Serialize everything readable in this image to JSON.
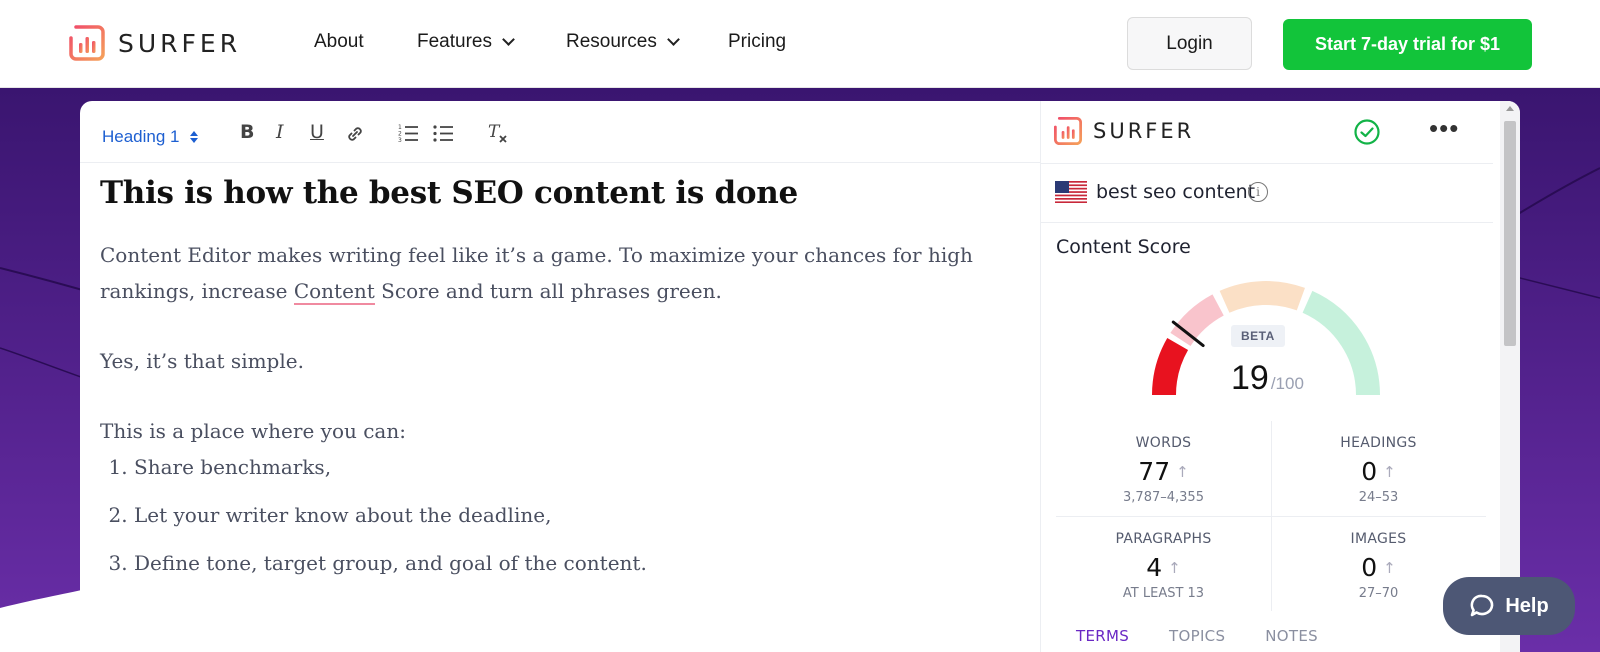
{
  "nav": {
    "logo_text": "SURFER",
    "items": [
      {
        "label": "About"
      },
      {
        "label": "Features"
      },
      {
        "label": "Resources"
      },
      {
        "label": "Pricing"
      }
    ],
    "login_label": "Login",
    "trial_label": "Start 7-day trial for $1"
  },
  "editor": {
    "toolbar": {
      "heading_select": "Heading 1",
      "icons": [
        "bold-icon",
        "italic-icon",
        "underline-icon",
        "link-icon",
        "ordered-list-icon",
        "bullet-list-icon",
        "clear-format-icon"
      ]
    },
    "title": "This is how the best SEO content is done",
    "para1_a": "Content Editor makes writing feel like it’s a game. To maximize your chances for high rankings, increase ",
    "para1_highlight": "Content",
    "para1_b": " Score and turn all phrases green.",
    "para2": "Yes, it’s that simple.",
    "para3": "This is a place where you can:",
    "list": [
      "Share benchmarks,",
      "Let your writer know about the deadline,",
      "Define tone, target group, and goal of the content."
    ]
  },
  "panel": {
    "logo_text": "SURFER",
    "keyword": "best seo content",
    "content_score_title": "Content Score",
    "beta": "BETA",
    "score": "19",
    "score_max": "/100",
    "score_value": 19,
    "stats": [
      {
        "label": "WORDS",
        "value": "77",
        "range": "3,787–4,355"
      },
      {
        "label": "HEADINGS",
        "value": "0",
        "range": "24–53"
      },
      {
        "label": "PARAGRAPHS",
        "value": "4",
        "range": "AT LEAST 13"
      },
      {
        "label": "IMAGES",
        "value": "0",
        "range": "27–70"
      }
    ],
    "tabs": [
      "TERMS",
      "TOPICS",
      "NOTES"
    ],
    "gauge_colors": {
      "red": "#e8121f",
      "pink": "#f9c4cc",
      "orange": "#fbe0c6",
      "green": "#c6f1dc"
    }
  },
  "help_label": "Help",
  "colors": {
    "accent_green": "#12c43a",
    "purple_bg": "#4a1a80",
    "link_blue": "#1d5fd1"
  }
}
